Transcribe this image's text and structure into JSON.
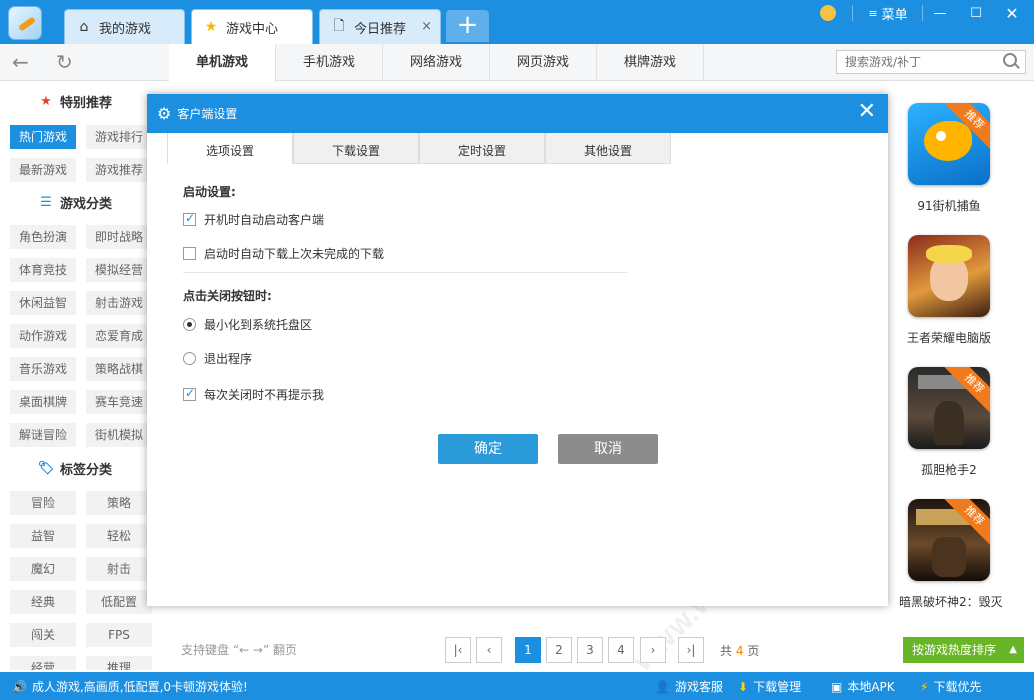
{
  "app": {
    "tabs": [
      {
        "label": "我的游戏",
        "icon": "home-icon"
      },
      {
        "label": "游戏中心",
        "icon": "star-icon"
      },
      {
        "label": "今日推荐",
        "icon": "document-icon"
      }
    ],
    "menu_label": "菜单",
    "accent": "#1c8fe0"
  },
  "nav": {
    "tabs": [
      "单机游戏",
      "手机游戏",
      "网络游戏",
      "网页游戏",
      "棋牌游戏"
    ],
    "search_placeholder": "搜索游戏/补丁"
  },
  "sidebar": {
    "featured": {
      "title": "特别推荐",
      "items": [
        "热门游戏",
        "游戏排行",
        "最新游戏",
        "游戏推荐"
      ]
    },
    "categories": {
      "title": "游戏分类",
      "items": [
        "角色扮演",
        "即时战略",
        "体育竞技",
        "模拟经营",
        "休闲益智",
        "射击游戏",
        "动作游戏",
        "恋爱育成",
        "音乐游戏",
        "策略战棋",
        "桌面棋牌",
        "赛车竞速",
        "解谜冒险",
        "街机模拟"
      ]
    },
    "tags": {
      "title": "标签分类",
      "items": [
        "冒险",
        "策略",
        "益智",
        "轻松",
        "魔幻",
        "射击",
        "经典",
        "低配置",
        "闯关",
        "FPS",
        "经营",
        "推理"
      ]
    }
  },
  "recommend": [
    {
      "name": "91街机捕鱼",
      "badge": "推荐"
    },
    {
      "name": "王者荣耀电脑版",
      "badge": ""
    },
    {
      "name": "孤胆枪手2",
      "badge": "推荐"
    },
    {
      "name": "暗黑破坏神2：毁灭",
      "badge": "推荐"
    }
  ],
  "dialog": {
    "title": "客户端设置",
    "tabs": [
      "选项设置",
      "下载设置",
      "定时设置",
      "其他设置"
    ],
    "startup_label": "启动设置:",
    "startup_options": [
      {
        "label": "开机时自动启动客户端",
        "checked": true
      },
      {
        "label": "启动时自动下载上次未完成的下载",
        "checked": false
      }
    ],
    "close_label": "点击关闭按钮时:",
    "close_options": [
      {
        "label": "最小化到系统托盘区",
        "selected": true
      },
      {
        "label": "退出程序",
        "selected": false
      }
    ],
    "no_prompt": {
      "label": "每次关闭时不再提示我",
      "checked": true
    },
    "ok_label": "确定",
    "cancel_label": "取消"
  },
  "pager": {
    "hint": "支持键盘 “← →” 翻页",
    "pages": [
      "1",
      "2",
      "3",
      "4"
    ],
    "current": 1,
    "total_prefix": "共",
    "total_pages": "4",
    "total_suffix": "页",
    "sort_label": "按游戏热度排序"
  },
  "statusbar": {
    "slogan": "成人游戏,高画质,低配置,0卡顿游戏体验!",
    "service": "游戏客服",
    "downloads": "下载管理",
    "apk": "本地APK",
    "priority": "下载优先"
  },
  "watermark": "WWW.WEIDOWN.COM"
}
